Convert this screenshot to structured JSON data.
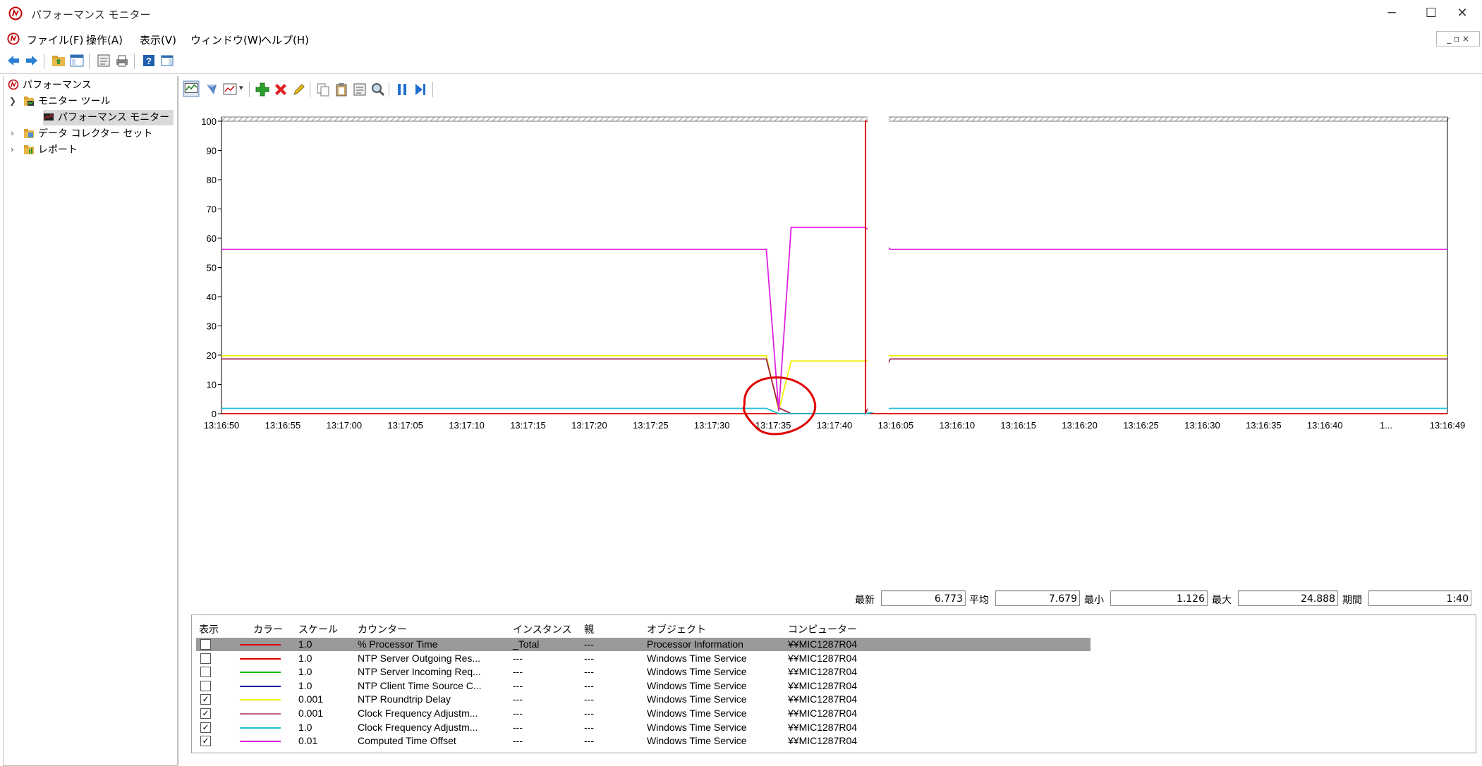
{
  "window": {
    "title": "パフォーマンス モニター",
    "min": "─",
    "max": "☐",
    "close": "✕"
  },
  "menu": [
    "ファイル(F)",
    "操作(A)",
    "表示(V)",
    "ウィンドウ(W)",
    "ヘルプ(H)"
  ],
  "tree": {
    "root": "パフォーマンス",
    "monitor_tools": "モニター ツール",
    "perf_monitor": "パフォーマンス モニター",
    "data_collector": "データ コレクター セット",
    "reports": "レポート"
  },
  "chart_data": {
    "type": "line",
    "ylim": [
      0,
      100
    ],
    "yticks": [
      "0",
      "10",
      "20",
      "30",
      "40",
      "50",
      "60",
      "70",
      "80",
      "90",
      "100"
    ],
    "xticks": [
      "13:16:50",
      "13:16:55",
      "13:17:00",
      "13:17:05",
      "13:17:10",
      "13:17:15",
      "13:17:20",
      "13:17:25",
      "13:17:30",
      "13:17:35",
      "13:17:40",
      "13:16:05",
      "13:16:10",
      "13:16:15",
      "13:16:20",
      "13:16:25",
      "13:16:30",
      "13:16:35",
      "13:16:40",
      "1...",
      "13:16:49"
    ],
    "grid": false,
    "sample_count": 100,
    "current_index": 52,
    "series": [
      {
        "color": "#e00000",
        "values": [
          [
            0,
            0
          ],
          [
            52,
            0
          ],
          [
            52,
            100
          ],
          [
            52.5,
            100
          ],
          [
            52.5,
            0
          ],
          [
            99,
            0
          ]
        ]
      },
      {
        "color": "#f0f000",
        "values": [
          [
            0,
            19.8
          ],
          [
            44,
            19.8
          ],
          [
            45,
            1
          ],
          [
            46,
            18
          ],
          [
            52,
            18
          ],
          [
            54,
            19.8
          ],
          [
            99,
            19.8
          ]
        ]
      },
      {
        "color": "#a0204a",
        "values": [
          [
            0,
            18.7
          ],
          [
            44,
            18.7
          ],
          [
            45,
            2
          ],
          [
            46,
            0
          ],
          [
            52,
            0
          ],
          [
            54,
            18.7
          ],
          [
            99,
            18.7
          ]
        ]
      },
      {
        "color": "#20c0d0",
        "values": [
          [
            0,
            1.8
          ],
          [
            44,
            1.8
          ],
          [
            45,
            0
          ],
          [
            52,
            0
          ],
          [
            54,
            1.8
          ],
          [
            99,
            1.8
          ]
        ]
      },
      {
        "color": "#e020e0",
        "values": [
          [
            0,
            56.2
          ],
          [
            44,
            56.2
          ],
          [
            45,
            1
          ],
          [
            46,
            63.7
          ],
          [
            52,
            63.7
          ],
          [
            54,
            56.2
          ],
          [
            99,
            56.2
          ]
        ]
      }
    ]
  },
  "stats": {
    "last_label": "最新",
    "last": "6.773",
    "avg_label": "平均",
    "avg": "7.679",
    "min_label": "最小",
    "min": "1.126",
    "max_label": "最大",
    "max": "24.888",
    "dur_label": "期間",
    "dur": "1:40"
  },
  "legend": {
    "headers": [
      "表示",
      "カラー",
      "スケール",
      "カウンター",
      "インスタンス",
      "親",
      "オブジェクト",
      "コンピューター"
    ],
    "rows": [
      {
        "checked": false,
        "color": "#e00000",
        "scale": "1.0",
        "counter": "% Processor Time",
        "instance": "_Total",
        "parent": "---",
        "object": "Processor Information",
        "computer": "¥¥MIC1287R04"
      },
      {
        "checked": false,
        "color": "#e00000",
        "scale": "1.0",
        "counter": "NTP Server Outgoing Res...",
        "instance": "---",
        "parent": "---",
        "object": "Windows Time Service",
        "computer": "¥¥MIC1287R04"
      },
      {
        "checked": false,
        "color": "#00c000",
        "scale": "1.0",
        "counter": "NTP Server Incoming Req...",
        "instance": "---",
        "parent": "---",
        "object": "Windows Time Service",
        "computer": "¥¥MIC1287R04"
      },
      {
        "checked": false,
        "color": "#2020a0",
        "scale": "1.0",
        "counter": "NTP Client Time Source C...",
        "instance": "---",
        "parent": "---",
        "object": "Windows Time Service",
        "computer": "¥¥MIC1287R04"
      },
      {
        "checked": true,
        "color": "#f0f000",
        "scale": "0.001",
        "counter": "NTP Roundtrip Delay",
        "instance": "---",
        "parent": "---",
        "object": "Windows Time Service",
        "computer": "¥¥MIC1287R04"
      },
      {
        "checked": true,
        "color": "#c06080",
        "scale": "0.001",
        "counter": "Clock Frequency Adjustm...",
        "instance": "---",
        "parent": "---",
        "object": "Windows Time Service",
        "computer": "¥¥MIC1287R04"
      },
      {
        "checked": true,
        "color": "#20c0d0",
        "scale": "1.0",
        "counter": "Clock Frequency Adjustm...",
        "instance": "---",
        "parent": "---",
        "object": "Windows Time Service",
        "computer": "¥¥MIC1287R04"
      },
      {
        "checked": true,
        "color": "#e020e0",
        "scale": "0.01",
        "counter": "Computed Time Offset",
        "instance": "---",
        "parent": "---",
        "object": "Windows Time Service",
        "computer": "¥¥MIC1287R04"
      }
    ]
  }
}
